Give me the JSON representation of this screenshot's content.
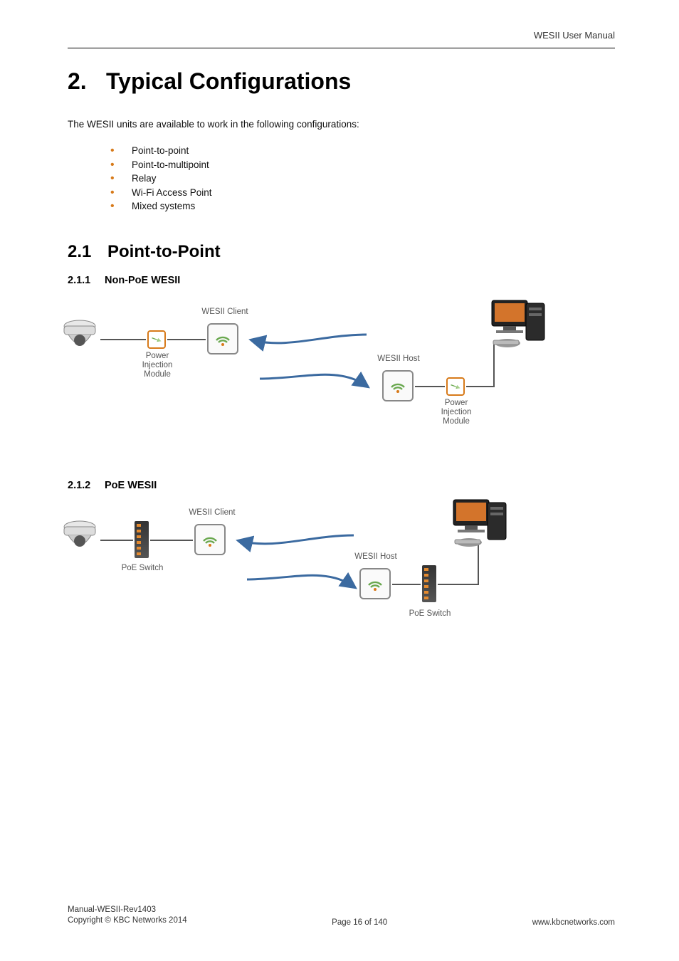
{
  "header": {
    "right": "WESII User Manual"
  },
  "title": {
    "number": "2.",
    "text": "Typical Configurations"
  },
  "intro": "The WESII units are available to work in the following configurations:",
  "bullets": [
    "Point-to-point",
    "Point-to-multipoint",
    "Relay",
    "Wi-Fi Access Point",
    "Mixed systems"
  ],
  "section21": {
    "number": "2.1",
    "title": "Point-to-Point"
  },
  "sub211": {
    "number": "2.1.1",
    "title": "Non-PoE WESII"
  },
  "sub212": {
    "number": "2.1.2",
    "title": "PoE WESII"
  },
  "diagram1": {
    "wesii_client": "WESII Client",
    "wesii_host": "WESII Host",
    "pim": "Power\nInjection\nModule"
  },
  "diagram2": {
    "wesii_client": "WESII Client",
    "wesii_host": "WESII Host",
    "poe_switch": "PoE Switch"
  },
  "footer": {
    "rev": "Manual-WESII-Rev1403",
    "copyright": "Copyright © KBC Networks 2014",
    "page": "Page 16 of 140",
    "url": "www.kbcnetworks.com"
  }
}
